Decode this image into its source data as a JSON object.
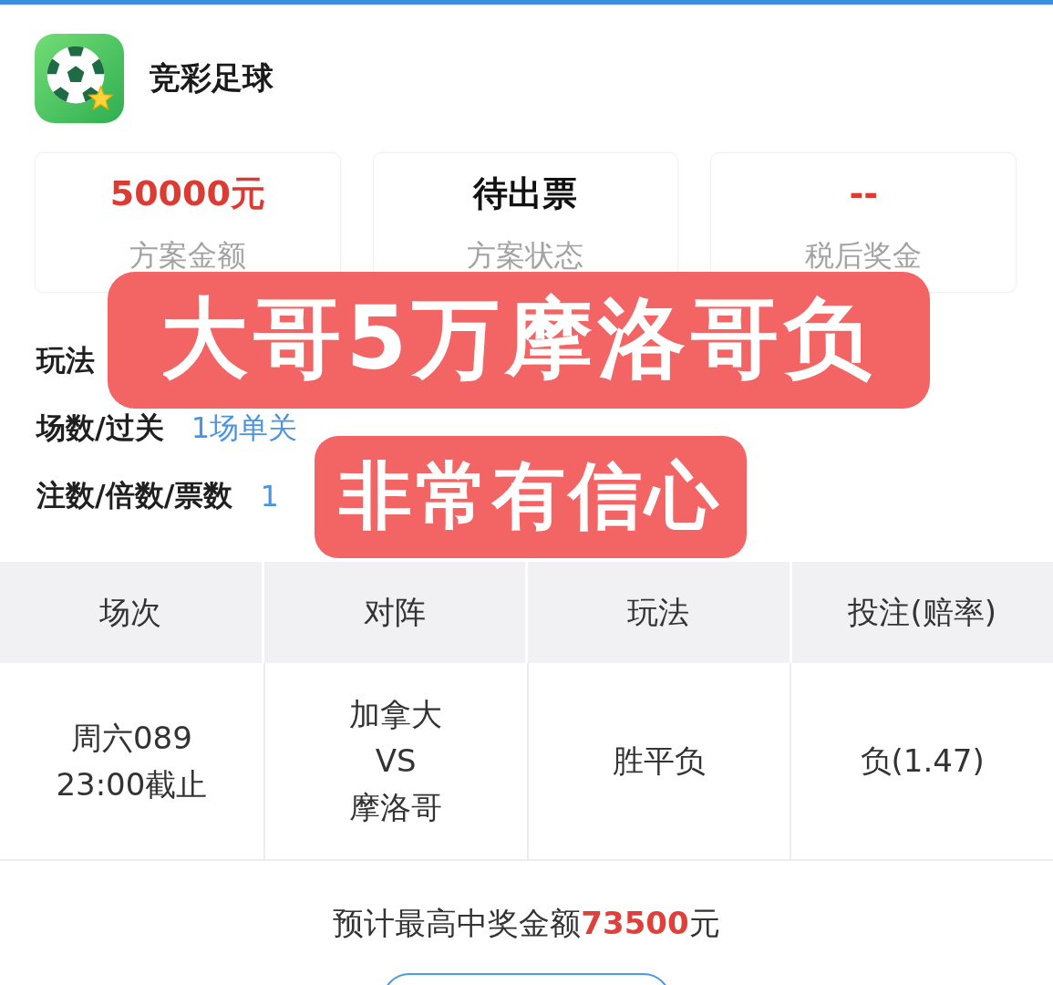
{
  "app": {
    "title": "竞彩足球"
  },
  "summary": [
    {
      "value": "50000元",
      "label": "方案金额",
      "kind": "amount"
    },
    {
      "value": "待出票",
      "label": "方案状态",
      "kind": "status"
    },
    {
      "value": "--",
      "label": "税后奖金",
      "kind": "amount"
    }
  ],
  "details": [
    {
      "label": "玩法"
    },
    {
      "label": "场数/过关",
      "value": "1场单关"
    },
    {
      "label": "注数/倍数/票数",
      "value": "1"
    }
  ],
  "overlay": {
    "headline": "大哥5万摩洛哥负",
    "subline": "非常有信心"
  },
  "table": {
    "columns": [
      "场次",
      "对阵",
      "玩法",
      "投注(赔率)"
    ],
    "rows": [
      [
        "周六089\n23:00截止",
        "加拿大\nVS\n摩洛哥",
        "胜平负",
        "负(1.47)"
      ]
    ]
  },
  "footer": {
    "text": "预计最高中奖金额**73500**元"
  }
}
